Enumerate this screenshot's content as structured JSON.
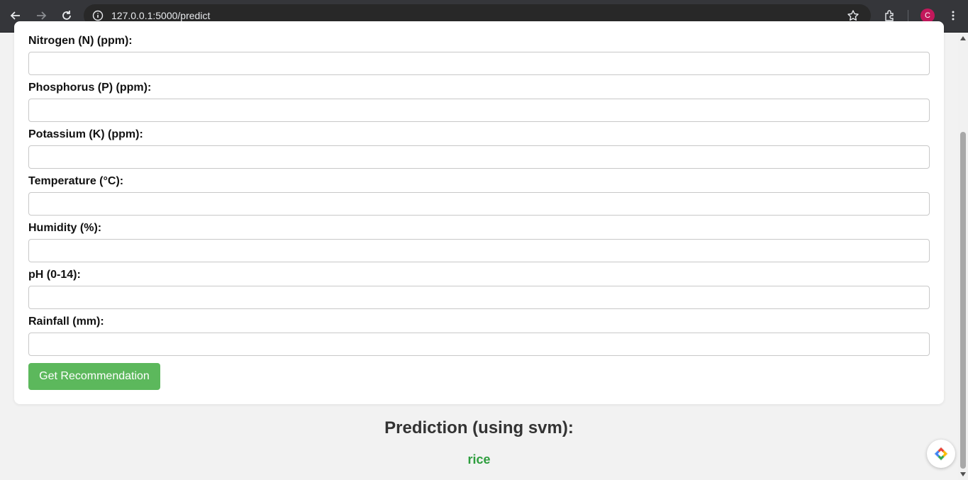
{
  "browser": {
    "url": "127.0.0.1:5000/predict",
    "profile_initial": "C",
    "profile_color": "#c2185b"
  },
  "form": {
    "fields": [
      {
        "label": "Nitrogen (N) (ppm):",
        "value": ""
      },
      {
        "label": "Phosphorus (P) (ppm):",
        "value": ""
      },
      {
        "label": "Potassium (K) (ppm):",
        "value": ""
      },
      {
        "label": "Temperature (°C):",
        "value": ""
      },
      {
        "label": "Humidity (%):",
        "value": ""
      },
      {
        "label": "pH (0-14):",
        "value": ""
      },
      {
        "label": "Rainfall (mm):",
        "value": ""
      }
    ],
    "submit_label": "Get Recommendation",
    "accent_color": "#5cb85c"
  },
  "prediction": {
    "title": "Prediction (using svm):",
    "value": "rice",
    "value_color": "#2e9e3e"
  }
}
